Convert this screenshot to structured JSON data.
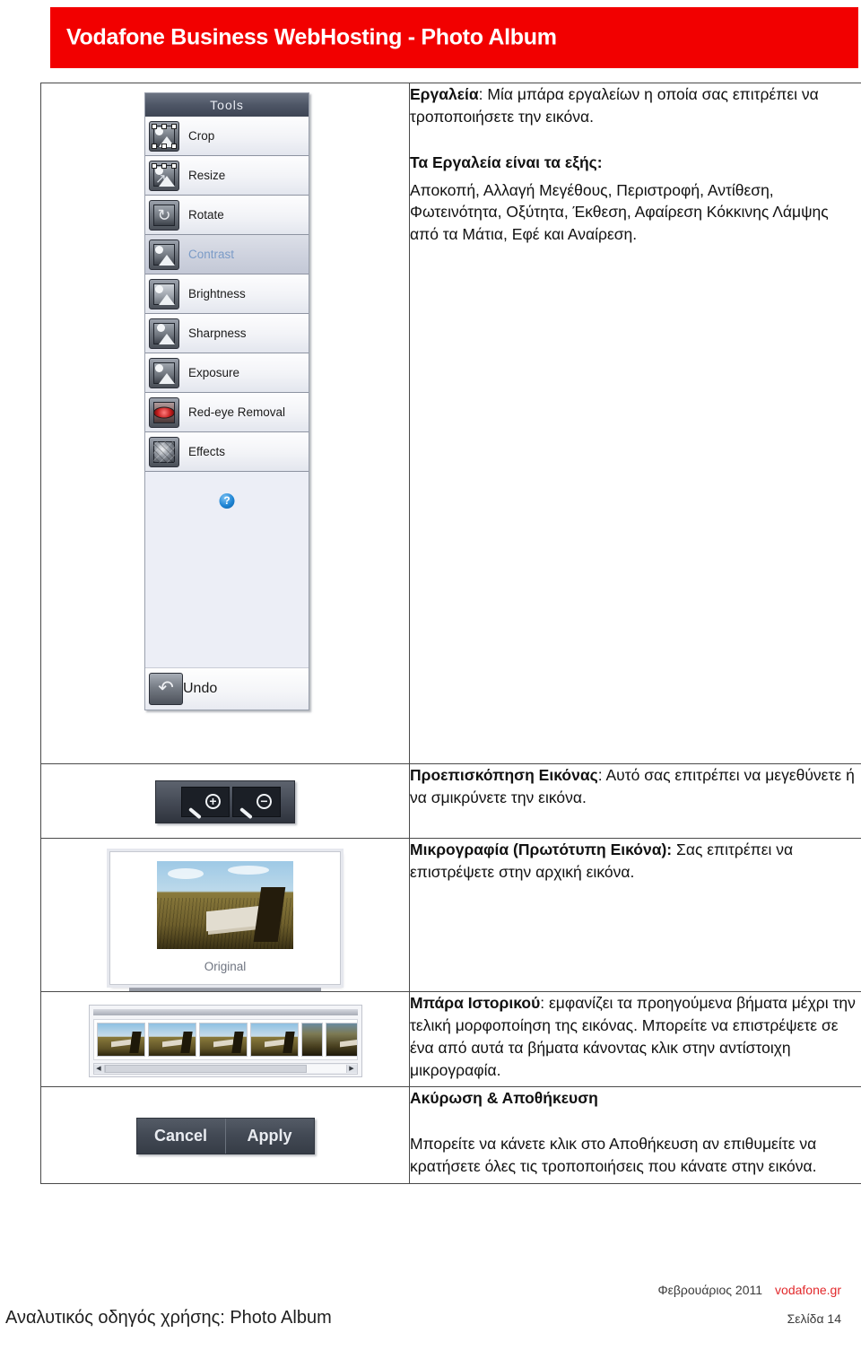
{
  "header": {
    "title": "Vodafone Business WebHosting - Photo Album",
    "bg_color": "#f20000",
    "text_color": "#ffffff"
  },
  "tools_panel": {
    "header_label": "Tools",
    "items": [
      {
        "label": "Crop",
        "icon": "crop-icon",
        "active": false
      },
      {
        "label": "Resize",
        "icon": "resize-icon",
        "active": false
      },
      {
        "label": "Rotate",
        "icon": "rotate-icon",
        "active": false
      },
      {
        "label": "Contrast",
        "icon": "contrast-icon",
        "active": true
      },
      {
        "label": "Brightness",
        "icon": "brightness-icon",
        "active": false
      },
      {
        "label": "Sharpness",
        "icon": "sharpness-icon",
        "active": false
      },
      {
        "label": "Exposure",
        "icon": "exposure-icon",
        "active": false
      },
      {
        "label": "Red-eye Removal",
        "icon": "red-eye-icon",
        "active": false
      },
      {
        "label": "Effects",
        "icon": "effects-icon",
        "active": false
      }
    ],
    "help_icon": "?",
    "undo_label": "Undo",
    "active_label_color": "#7b9bc7"
  },
  "zoom_controls": {
    "zoom_in_sign": "+",
    "zoom_out_sign": "−"
  },
  "original_panel": {
    "caption": "Original"
  },
  "history_panel": {
    "thumbnail_count": 6,
    "scroll_left_arrow": "◀",
    "scroll_right_arrow": "▶"
  },
  "actions": {
    "cancel_label": "Cancel",
    "apply_label": "Apply"
  },
  "rows": [
    {
      "id": "tools",
      "paragraphs": [
        {
          "bold": "Εργαλεία",
          "text": ": Μία μπάρα εργαλείων η οποία σας επιτρέπει να τροποποιήσετε την εικόνα.",
          "spaced": false
        },
        {
          "bold": "Τα Εργαλεία είναι τα εξής:",
          "text": "",
          "spaced": true
        },
        {
          "bold": "",
          "text": "Αποκοπή, Αλλαγή Μεγέθους, Περιστροφή, Αντίθεση, Φωτεινότητα, Οξύτητα, Έκθεση, Αφαίρεση Κόκκινης Λάμψης από τα Μάτια, Εφέ και Αναίρεση.",
          "spaced": false
        }
      ]
    },
    {
      "id": "preview",
      "paragraphs": [
        {
          "bold": "Προεπισκόπηση Εικόνας",
          "text": ": Αυτό σας επιτρέπει να μεγεθύνετε ή να σμικρύνετε την εικόνα.",
          "spaced": false
        }
      ]
    },
    {
      "id": "thumbnail",
      "paragraphs": [
        {
          "bold": "Μικρογραφία (Πρωτότυπη Εικόνα):",
          "text": " Σας επιτρέπει να επιστρέψετε στην αρχική εικόνα.",
          "spaced": false
        }
      ]
    },
    {
      "id": "history",
      "paragraphs": [
        {
          "bold": "Μπάρα Ιστορικού",
          "text": ": εμφανίζει τα προηγούμενα βήματα μέχρι την τελική μορφοποίηση της εικόνας. Μπορείτε να επιστρέψετε σε ένα από αυτά τα βήματα κάνοντας κλικ στην αντίστοιχη μικρογραφία.",
          "spaced": false
        }
      ]
    },
    {
      "id": "cancel-save",
      "paragraphs": [
        {
          "bold": "Ακύρωση & Αποθήκευση",
          "text": "",
          "spaced": false
        },
        {
          "bold": "",
          "text": "Μπορείτε να κάνετε κλικ στο Αποθήκευση αν επιθυμείτε να κρατήσετε όλες τις τροποποιήσεις που κάνατε στην εικόνα.",
          "spaced": true
        }
      ]
    }
  ],
  "footer": {
    "date": "Φεβρουάριος 2011",
    "url": "vodafone.gr",
    "url_color": "#e2282b",
    "page": "Σελίδα 14",
    "guide": "Αναλυτικός οδηγός χρήσης: Photo Album"
  }
}
